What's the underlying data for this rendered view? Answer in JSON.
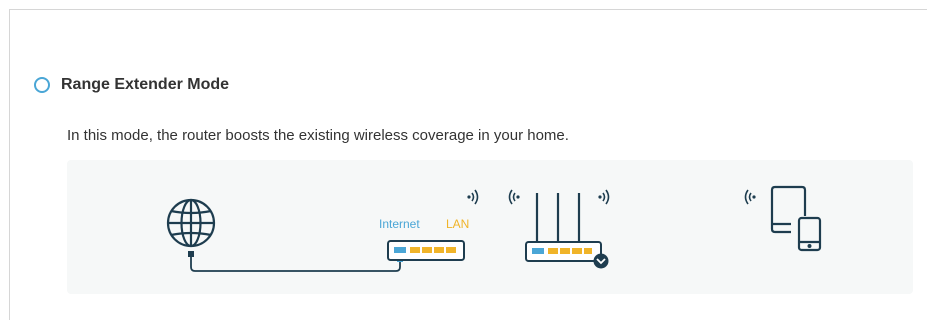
{
  "mode": {
    "label": "Range Extender Mode",
    "selected": false,
    "description": "In this mode, the router boosts the existing wireless coverage in your home."
  },
  "diagram": {
    "port_labels": {
      "internet": "Internet",
      "lan": "LAN"
    },
    "icons": [
      "globe-icon",
      "modem-icon",
      "wifi-signal-icon",
      "router-icon",
      "tablet-icon",
      "phone-icon"
    ],
    "colors": {
      "accent": "#4aa6d6",
      "lan_port": "#f0b429",
      "line": "#1e3d4f",
      "radio_border": "#4aa6d6"
    }
  }
}
